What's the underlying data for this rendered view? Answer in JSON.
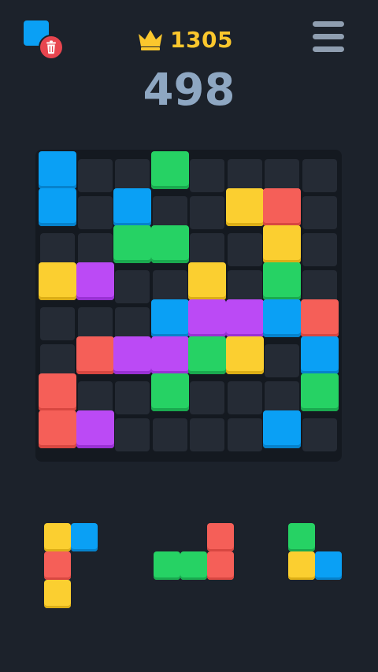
{
  "header": {
    "best_score": "1305",
    "current_score": "498",
    "crown_icon": "crown-icon",
    "remove_icon": "trash-icon",
    "menu_icon": "hamburger-menu-icon"
  },
  "colors": {
    "background": "#1c222b",
    "board": "#141920",
    "empty_cell": "#252b35",
    "blue": "#0aa0f5",
    "green": "#26d264",
    "yellow": "#fbcf30",
    "red": "#f55f58",
    "purple": "#bb4af5",
    "score_text": "#8ea7c2",
    "best_text": "#fbc72d"
  },
  "board": {
    "rows": 8,
    "cols": 8,
    "cells": [
      [
        "blue",
        null,
        null,
        "green",
        null,
        null,
        null,
        null
      ],
      [
        "blue",
        null,
        "blue",
        null,
        null,
        "yellow",
        "red",
        null
      ],
      [
        null,
        null,
        "green",
        "green",
        null,
        null,
        "yellow",
        null
      ],
      [
        "yellow",
        "purple",
        null,
        null,
        "yellow",
        null,
        "green",
        null
      ],
      [
        null,
        null,
        null,
        "blue",
        "purple",
        "purple",
        "blue",
        "red"
      ],
      [
        null,
        "red",
        "purple",
        "purple",
        "green",
        "yellow",
        null,
        "blue"
      ],
      [
        "red",
        null,
        null,
        "green",
        null,
        null,
        null,
        "green"
      ],
      [
        "red",
        "purple",
        null,
        null,
        null,
        null,
        "blue",
        null
      ]
    ]
  },
  "pieces": [
    {
      "name": "piece-1",
      "cells": [
        [
          0,
          0,
          "yellow"
        ],
        [
          0,
          1,
          "blue"
        ],
        [
          1,
          0,
          "red"
        ],
        [
          2,
          0,
          "yellow"
        ]
      ]
    },
    {
      "name": "piece-2",
      "cells": [
        [
          0,
          2,
          "red"
        ],
        [
          1,
          0,
          "green"
        ],
        [
          1,
          1,
          "green"
        ],
        [
          1,
          2,
          "red"
        ]
      ]
    },
    {
      "name": "piece-3",
      "cells": [
        [
          0,
          0,
          "green"
        ],
        [
          1,
          0,
          "yellow"
        ],
        [
          1,
          1,
          "blue"
        ]
      ]
    }
  ]
}
